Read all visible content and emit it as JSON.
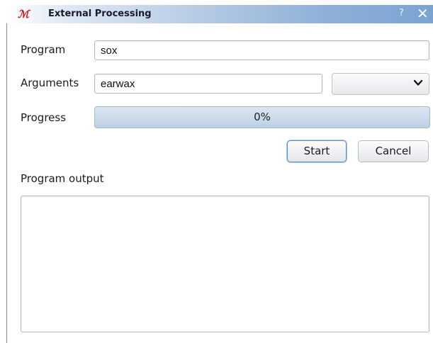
{
  "window": {
    "app_icon": "krec-app-icon",
    "app_icon_text": "ℳ",
    "title": "External Processing",
    "help_label": "?",
    "close_label": "✕"
  },
  "form": {
    "program_label": "Program",
    "program_value": "sox",
    "arguments_label": "Arguments",
    "arguments_value": "earwax",
    "preset_selected": "",
    "progress_label": "Progress",
    "progress_text": "0%",
    "progress_fraction": 0
  },
  "actions": {
    "start_label": "Start",
    "cancel_label": "Cancel"
  },
  "output": {
    "label": "Program output",
    "text": ""
  },
  "colors": {
    "title_gradient_end": "#7aa3d2",
    "progress_fill": "#bcd0e4",
    "default_button_border": "#5f8fc7"
  }
}
